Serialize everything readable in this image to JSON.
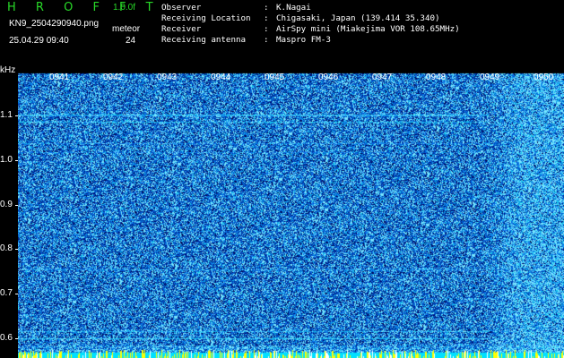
{
  "header": {
    "app_title": "H R O F F T",
    "version": "1.0.0f",
    "filename": "KN9_2504290940.png",
    "timestamp": "25.04.29 09:40",
    "mode": "meteor",
    "count": "24"
  },
  "metadata": [
    {
      "label": "Observer",
      "value": "K.Nagai"
    },
    {
      "label": "Receiving Location",
      "value": "Chigasaki, Japan (139.414 35.340)"
    },
    {
      "label": "Receiver",
      "value": "AirSpy mini (Miakejima VOR 108.65MHz)"
    },
    {
      "label": "Receiving antenna",
      "value": "Maspro FM-3"
    }
  ],
  "spectrogram": {
    "y_unit": "kHz",
    "y_ticks": [
      "1.1",
      "1.0",
      "0.9",
      "0.8",
      "0.7",
      "0.6"
    ],
    "time_labels": [
      "0941",
      "0942",
      "0943",
      "0944",
      "0945",
      "0946",
      "0947",
      "0948",
      "0949",
      "0950"
    ],
    "colors": {
      "background": "#000000",
      "noise_low": "#001a70",
      "noise_mid": "#1560ff",
      "noise_high": "#40d8ff",
      "hot": "#ffff00",
      "text_green": "#28d828"
    }
  }
}
